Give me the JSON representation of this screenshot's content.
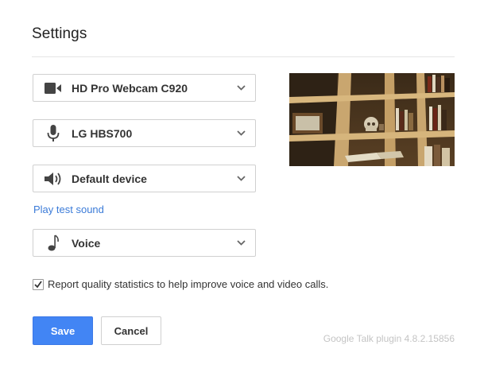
{
  "dialog": {
    "title": "Settings",
    "camera": {
      "label": "HD Pro Webcam C920",
      "icon": "video-camera-icon"
    },
    "microphone": {
      "label": "LG HBS700",
      "icon": "microphone-icon"
    },
    "speaker": {
      "label": "Default device",
      "icon": "speaker-icon"
    },
    "play_test_sound": "Play test sound",
    "ringtone": {
      "label": "Voice",
      "icon": "music-note-icon"
    },
    "report_checkbox": {
      "checked": true,
      "label": "Report quality statistics to help improve voice and video calls."
    },
    "save_label": "Save",
    "cancel_label": "Cancel",
    "version": "Google Talk plugin 4.8.2.15856"
  },
  "colors": {
    "accent": "#4285f4",
    "link": "#3b7bd8",
    "version_text": "#c4c4c4"
  }
}
